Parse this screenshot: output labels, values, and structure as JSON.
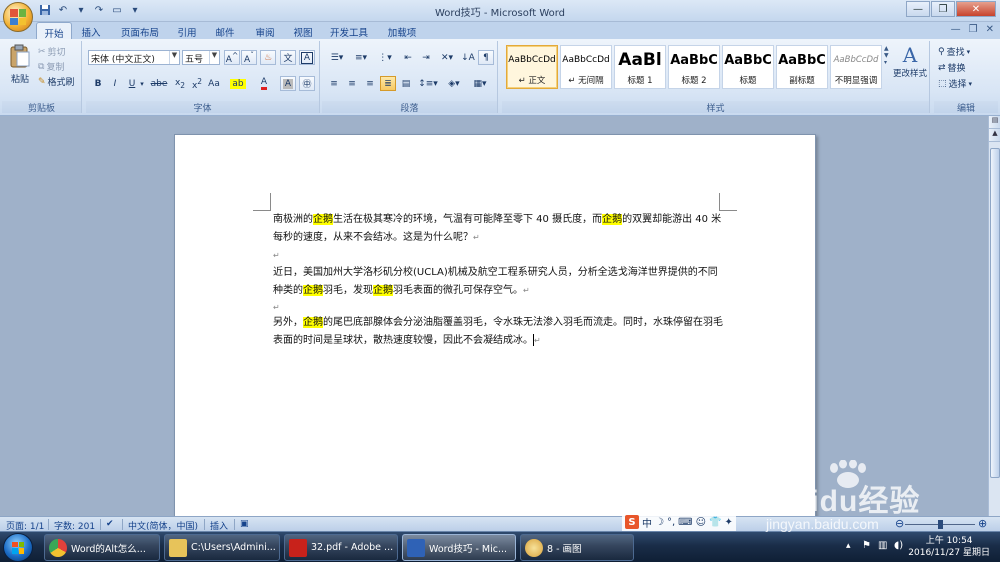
{
  "window": {
    "title": "Word技巧 - Microsoft Word"
  },
  "tabs": [
    "开始",
    "插入",
    "页面布局",
    "引用",
    "邮件",
    "审阅",
    "视图",
    "开发工具",
    "加载项"
  ],
  "ribbon": {
    "clipboard": {
      "paste": "粘贴",
      "cut": "剪切",
      "copy": "复制",
      "format_painter": "格式刷",
      "label": "剪贴板"
    },
    "font": {
      "font_name": "宋体 (中文正文)",
      "font_size": "五号",
      "label": "字体"
    },
    "paragraph": {
      "label": "段落"
    },
    "styles": {
      "items": [
        {
          "sample": "AaBbCcDd",
          "name": "↵ 正文"
        },
        {
          "sample": "AaBbCcDd",
          "name": "↵ 无间隔"
        },
        {
          "sample": "AaBl",
          "name": "标题 1"
        },
        {
          "sample": "AaBbC",
          "name": "标题 2"
        },
        {
          "sample": "AaBbC",
          "name": "标题"
        },
        {
          "sample": "AaBbC",
          "name": "副标题"
        },
        {
          "sample": "AaBbCcDd",
          "name": "不明显强调"
        }
      ],
      "change_styles": "更改样式",
      "label": "样式"
    },
    "editing": {
      "find": "查找",
      "replace": "替换",
      "select": "选择",
      "label": "编辑"
    }
  },
  "document": {
    "paragraphs": [
      {
        "parts": [
          {
            "t": "南极洲的",
            "hl": false
          },
          {
            "t": "企鹅",
            "hl": true
          },
          {
            "t": "生活在极其寒冷的环境，气温有可能降至零下 40 摄氏度，而",
            "hl": false
          },
          {
            "t": "企鹅",
            "hl": true
          },
          {
            "t": "的双翼却能游出 40 米每秒的速度，从来不会结冰。这是为什么呢？",
            "hl": false
          }
        ]
      },
      {
        "parts": [
          {
            "t": "近日，美国加州大学洛杉矶分校(UCLA)机械及航空工程系研究人员，分析全选戈海洋世界提供的不同种类的",
            "hl": false
          },
          {
            "t": "企鹅",
            "hl": true
          },
          {
            "t": "羽毛，发现",
            "hl": false
          },
          {
            "t": "企鹅",
            "hl": true
          },
          {
            "t": "羽毛表面的微孔可保存空气。",
            "hl": false
          }
        ]
      },
      {
        "parts": [
          {
            "t": "另外，",
            "hl": false
          },
          {
            "t": "企鹅",
            "hl": true
          },
          {
            "t": "的尾巴底部腺体会分泌油脂覆盖羽毛，令水珠无法渗入羽毛而流走。同时，水珠停留在羽毛表面的时间是呈球状，散热速度较慢，因此不会凝结成冰。",
            "hl": false
          }
        ]
      }
    ]
  },
  "statusbar": {
    "page": "页面: 1/1",
    "words": "字数: 201",
    "language": "中文(简体，中国)",
    "insert_mode": "插入"
  },
  "taskbar": {
    "buttons": [
      {
        "label": "Word的Alt怎么...",
        "color": "#e2413b"
      },
      {
        "label": "C:\\Users\\Admini...",
        "color": "#e7c35a"
      },
      {
        "label": "32.pdf - Adobe ...",
        "color": "#c8221b"
      },
      {
        "label": "Word技巧 - Mic...",
        "color": "#2f62b6"
      },
      {
        "label": "8 - 画图",
        "color": "#d9a23b"
      }
    ],
    "clock_time": "上午 10:54",
    "clock_date": "2016/11/27 星期日"
  },
  "ime": {
    "brand": "S",
    "mode": "中"
  },
  "watermark": {
    "brand": "Baidu经验",
    "url": "jingyan.baidu.com"
  }
}
